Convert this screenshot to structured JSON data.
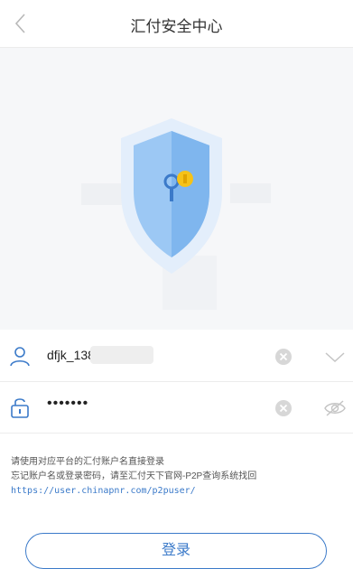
{
  "header": {
    "title": "汇付安全中心"
  },
  "login_form": {
    "username_value": "dfjk_138",
    "password_value": "•••••••"
  },
  "hint": {
    "line1": "请使用对应平台的汇付账户名直接登录",
    "line2": "忘记账户名或登录密码，请至汇付天下官网-P2P查询系统找回",
    "link": "https://user.chinapnr.com/p2puser/"
  },
  "actions": {
    "login_label": "登录"
  },
  "colors": {
    "accent": "#3b7ac9",
    "shield_light": "#d9e9fb",
    "shield_mid": "#8fc1f2",
    "key": "#f5c218"
  },
  "icons": {
    "back": "chevron-left-icon",
    "hero": "shield-key-icon",
    "user": "user-icon",
    "lock": "lock-icon",
    "clear": "clear-icon",
    "dropdown": "chevron-down-icon",
    "visibility": "eye-off-icon"
  }
}
